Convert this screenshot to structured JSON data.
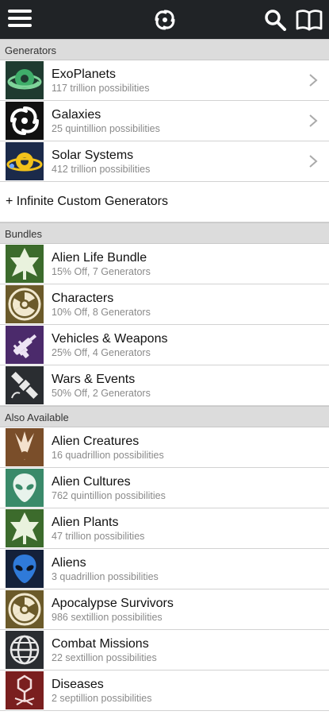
{
  "sections": {
    "generators": "Generators",
    "bundles": "Bundles",
    "also_available": "Also Available"
  },
  "generators": [
    {
      "title": "ExoPlanets",
      "sub": "117 trillion possibilities",
      "icon": "planet-icon"
    },
    {
      "title": "Galaxies",
      "sub": "25 quintillion possibilities",
      "icon": "galaxy-icon"
    },
    {
      "title": "Solar Systems",
      "sub": "412 trillion possibilities",
      "icon": "solar-system-icon"
    }
  ],
  "custom_generators": "+ Infinite Custom Generators",
  "bundles": [
    {
      "title": "Alien Life Bundle",
      "sub": "15% Off, 7 Generators",
      "icon": "plant-icon"
    },
    {
      "title": "Characters",
      "sub": "10% Off, 8 Generators",
      "icon": "radiation-icon"
    },
    {
      "title": "Vehicles & Weapons",
      "sub": "25% Off, 4 Generators",
      "icon": "ray-gun-icon"
    },
    {
      "title": "Wars & Events",
      "sub": "50% Off, 2 Generators",
      "icon": "satellite-icon"
    }
  ],
  "also_available": [
    {
      "title": "Alien Creatures",
      "sub": "16 quadrillion possibilities",
      "icon": "claw-icon"
    },
    {
      "title": "Alien Cultures",
      "sub": "762 quintillion possibilities",
      "icon": "alien-head-icon"
    },
    {
      "title": "Alien Plants",
      "sub": "47 trillion possibilities",
      "icon": "plant-icon"
    },
    {
      "title": "Aliens",
      "sub": "3 quadrillion possibilities",
      "icon": "alien-face-icon"
    },
    {
      "title": "Apocalypse Survivors",
      "sub": "986 sextillion possibilities",
      "icon": "radiation-icon"
    },
    {
      "title": "Combat Missions",
      "sub": "22 sextillion possibilities",
      "icon": "globe-icon"
    },
    {
      "title": "Diseases",
      "sub": "2 septillion possibilities",
      "icon": "virus-icon"
    }
  ],
  "colors": {
    "topbar": "#202326",
    "section_bg": "#dcdcdc",
    "subtext": "#8a8a8a"
  }
}
